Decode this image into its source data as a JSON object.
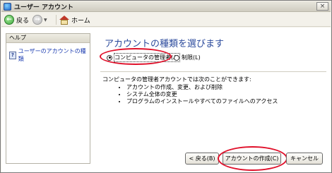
{
  "window": {
    "title": "ユーザー アカウント",
    "close_label": "×"
  },
  "toolbar": {
    "back_label": "戻る",
    "forward_label": "",
    "home_label": "ホーム"
  },
  "sidebar": {
    "header": "ヘルプ",
    "help_link": "ユーザーのアカウントの種類"
  },
  "main": {
    "title": "アカウントの種類を選びます",
    "options": [
      {
        "label": "コンピュータの管理者(A)",
        "selected": true
      },
      {
        "label": "制限(L)",
        "selected": false
      }
    ],
    "description": "コンピュータの管理者アカウントでは次のことができます:",
    "capabilities": [
      "アカウントの作成、変更、および削除",
      "システム全体の変更",
      "プログラムのインストールやすべてのファイルへのアクセス"
    ]
  },
  "buttons": {
    "back": "< 戻る(B)",
    "create": "アカウントの作成(C)",
    "cancel": "キャンセル"
  },
  "colors": {
    "title_blue": "#2b4a9c",
    "link_blue": "#1a3bb0",
    "annotation_red": "#e0102a"
  }
}
